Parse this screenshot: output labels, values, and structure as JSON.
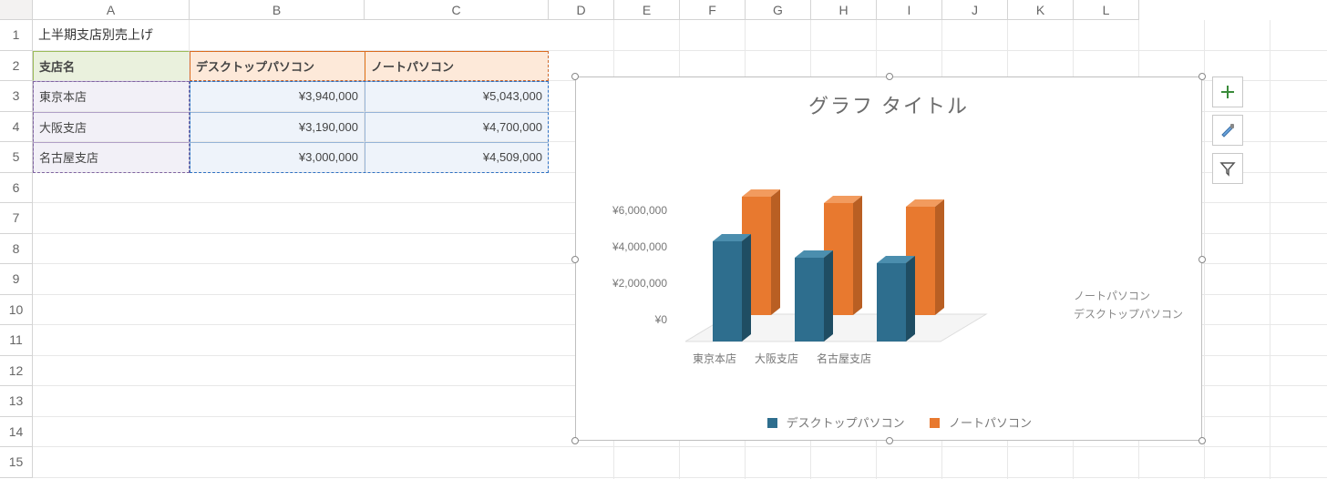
{
  "columns": [
    "A",
    "B",
    "C",
    "D",
    "E",
    "F",
    "G",
    "H",
    "I",
    "J",
    "K",
    "L"
  ],
  "rows": [
    "1",
    "2",
    "3",
    "4",
    "5",
    "6",
    "7",
    "8",
    "9",
    "10",
    "11",
    "12",
    "13",
    "14",
    "15"
  ],
  "table": {
    "title": "上半期支店別売上げ",
    "header": {
      "branch": "支店名",
      "desktop": "デスクトップパソコン",
      "laptop": "ノートパソコン"
    },
    "rows": [
      {
        "branch": "東京本店",
        "desktop": "¥3,940,000",
        "laptop": "¥5,043,000"
      },
      {
        "branch": "大阪支店",
        "desktop": "¥3,190,000",
        "laptop": "¥4,700,000"
      },
      {
        "branch": "名古屋支店",
        "desktop": "¥3,000,000",
        "laptop": "¥4,509,000"
      }
    ]
  },
  "chart": {
    "title": "グラフ タイトル",
    "yticks": [
      "¥6,000,000",
      "¥4,000,000",
      "¥2,000,000",
      "¥0"
    ],
    "seriesLabels": {
      "back": "ノートパソコン",
      "front": "デスクトップパソコン"
    },
    "legend": {
      "s1": "デスクトップパソコン",
      "s2": "ノートパソコン"
    },
    "colors": {
      "desktop": "#2e6e8e",
      "laptop": "#e8792f"
    }
  },
  "chart_data": {
    "type": "bar",
    "title": "グラフ タイトル",
    "categories": [
      "東京本店",
      "大阪支店",
      "名古屋支店"
    ],
    "series": [
      {
        "name": "デスクトップパソコン",
        "values": [
          3940000,
          3190000,
          3000000
        ]
      },
      {
        "name": "ノートパソコン",
        "values": [
          5043000,
          4700000,
          4509000
        ]
      }
    ],
    "ylabel": "",
    "xlabel": "",
    "ylim": [
      0,
      6000000
    ],
    "yticks": [
      0,
      2000000,
      4000000,
      6000000
    ]
  },
  "sideButtons": {
    "plus": "+",
    "brush": "brush",
    "filter": "filter"
  }
}
